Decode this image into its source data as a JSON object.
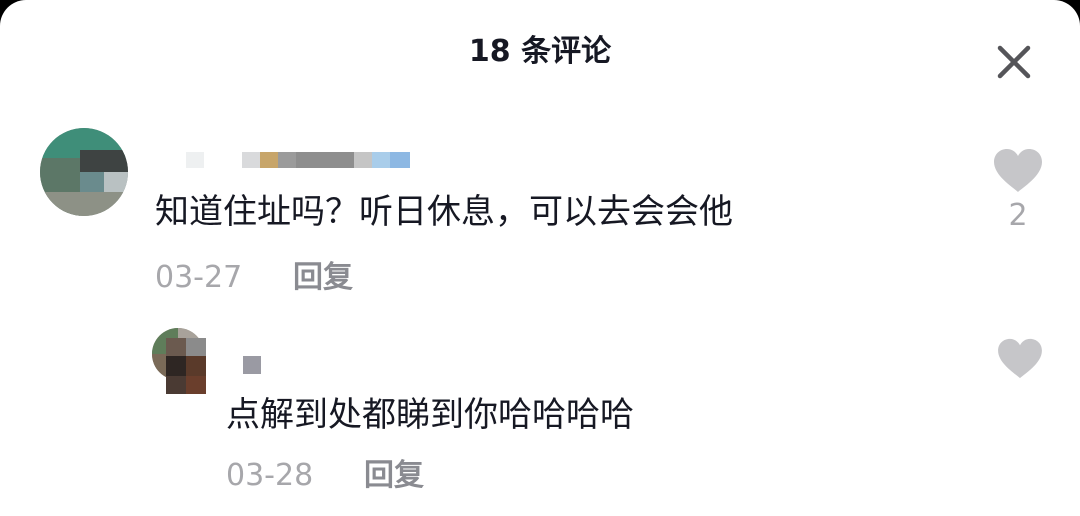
{
  "header": {
    "title": "18 条评论"
  },
  "icons": {
    "close": "close-icon",
    "like": "heart-icon"
  },
  "comments": [
    {
      "text": "知道住址吗？听日休息，可以去会会他",
      "date": "03-27",
      "reply_label": "回复",
      "like_count": "2"
    },
    {
      "text": "点解到处都睇到你哈哈哈哈",
      "date": "03-28",
      "reply_label": "回复",
      "like_count": ""
    }
  ],
  "colors": {
    "text_primary": "#161823",
    "text_secondary": "#a7a7ab",
    "heart": "#c6c6c9"
  }
}
